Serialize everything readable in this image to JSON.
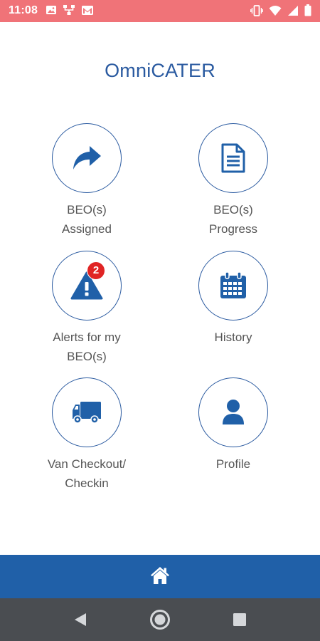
{
  "status_bar": {
    "time": "11:08",
    "background_color": "#f07378",
    "left_icons": [
      "image-icon",
      "network-icon",
      "gmail-icon"
    ],
    "right_icons": [
      "vibrate-icon",
      "wifi-icon",
      "signal-icon",
      "battery-icon"
    ]
  },
  "app": {
    "logo": "OmniCATER",
    "brand_color": "#2a5aa0"
  },
  "menu": {
    "beo_assigned": {
      "line1": "BEO(s)",
      "line2": "Assigned",
      "icon": "share-arrow-icon"
    },
    "beo_progress": {
      "line1": "BEO(s)",
      "line2": "Progress",
      "icon": "document-icon"
    },
    "alerts": {
      "line1": "Alerts for my",
      "line2": "BEO(s)",
      "icon": "warning-icon",
      "badge": "2"
    },
    "history": {
      "line1": "History",
      "icon": "calendar-icon"
    },
    "van_checkout": {
      "line1": "Van Checkout/",
      "line2": "Checkin",
      "icon": "truck-icon"
    },
    "profile": {
      "line1": "Profile",
      "icon": "user-icon"
    }
  },
  "bottom_bar": {
    "icon": "home-icon",
    "background_color": "#2060a8"
  },
  "nav_bar": {
    "icons": [
      "back-icon",
      "home-circle-icon",
      "recents-icon"
    ]
  }
}
